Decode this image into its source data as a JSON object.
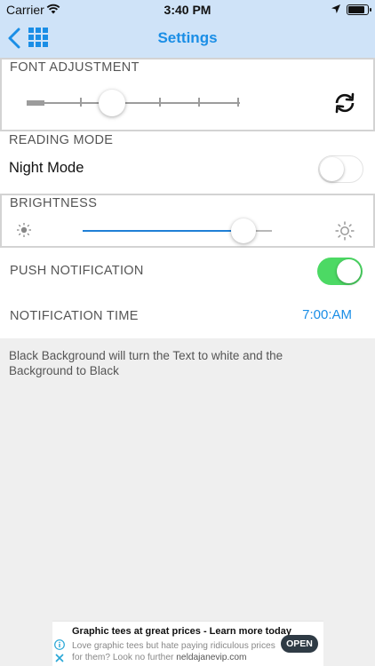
{
  "status_bar": {
    "carrier": "Carrier",
    "time": "3:40 PM",
    "icons": [
      "wifi-icon",
      "location-arrow-icon",
      "battery-icon"
    ]
  },
  "nav": {
    "title": "Settings",
    "icons": [
      "back-chevron-icon",
      "grid-menu-icon"
    ],
    "accent_color": "#1a8ee6",
    "background_color": "#cfe3f8"
  },
  "font_adjustment": {
    "label": "FONT ADJUSTMENT",
    "steps": 7,
    "selected_step": 3,
    "reset_icon": "refresh-icon"
  },
  "reading_mode": {
    "label": "READING MODE",
    "night_mode_label": "Night Mode",
    "night_mode_on": false
  },
  "brightness": {
    "label": "BRIGHTNESS",
    "value": 0.85,
    "min_icon": "sun-small-icon",
    "max_icon": "sun-large-icon"
  },
  "push": {
    "label": "PUSH NOTIFICATION",
    "enabled": true,
    "toggle_color": "#4cd964"
  },
  "notification_time": {
    "label": "NOTIFICATION TIME",
    "value": "7:00:AM"
  },
  "description": "Black Background will turn the Text to white and the Background to Black",
  "ad": {
    "title": "Graphic tees at great prices - Learn more today",
    "body": "Love graphic tees but hate paying ridiculous prices for them? Look no further",
    "domain": "neldajanevip.com",
    "cta": "OPEN"
  }
}
